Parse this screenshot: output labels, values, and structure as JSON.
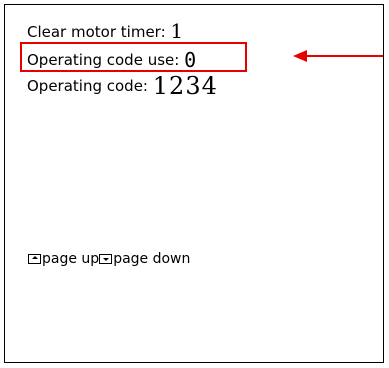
{
  "rows": {
    "clear_motor_timer": {
      "label": "Clear motor timer:",
      "value": "1"
    },
    "operating_code_use": {
      "label": "Operating code use:",
      "value": "0"
    },
    "operating_code": {
      "label": "Operating code:",
      "value": "1234"
    }
  },
  "nav_hint": {
    "page_up_label": "page up",
    "page_down_label": "page down",
    "page_up_icon": "page-up-key-icon",
    "page_down_icon": "page-down-key-icon"
  },
  "annotation": {
    "color": "#e60000"
  }
}
